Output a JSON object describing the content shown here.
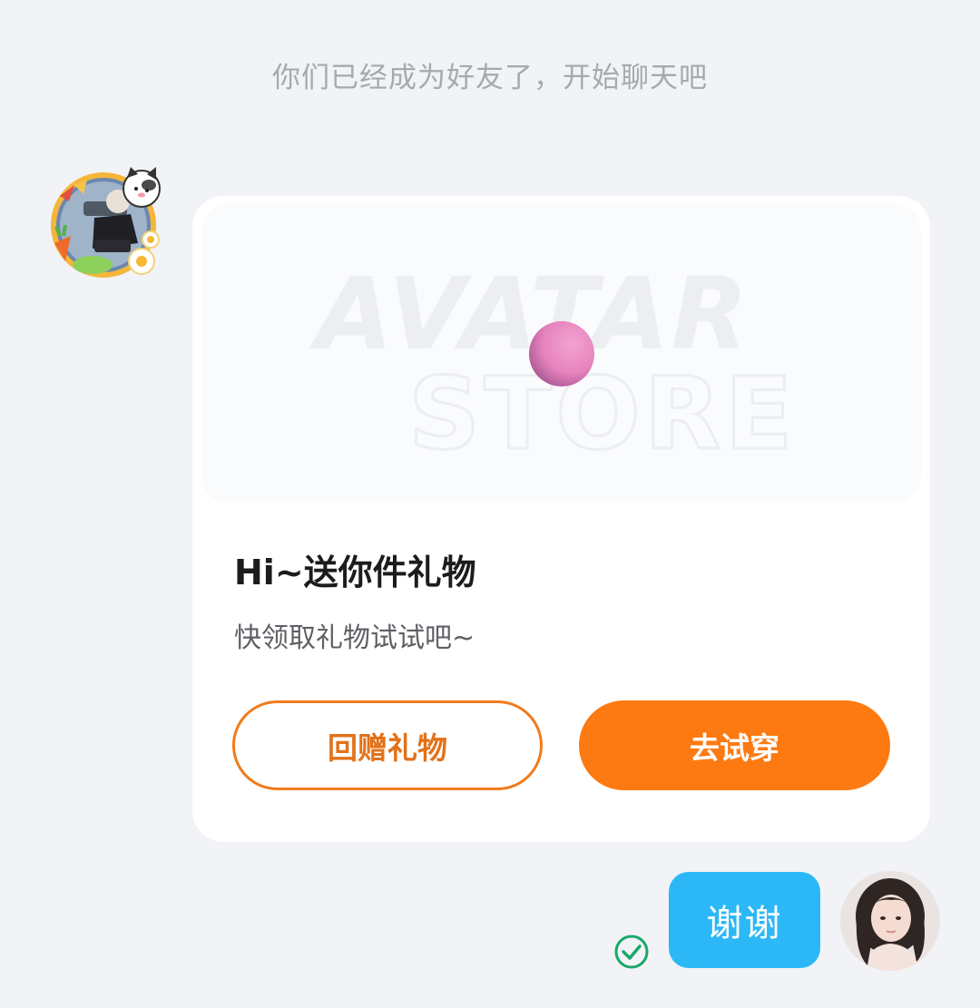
{
  "chat": {
    "system_message": "你们已经成为好友了，开始聊天吧"
  },
  "friend": {
    "avatar_icon": "friend-avatar-with-cat-frame"
  },
  "gift_card": {
    "preview_watermark_line1": "AVATAR",
    "preview_watermark_line2": "STORE",
    "title": "Hi~送你件礼物",
    "subtitle": "快领取礼物试试吧~",
    "return_gift_label": "回赠礼物",
    "try_on_label": "去试穿",
    "colors": {
      "accent": "#fd7a12",
      "outline": "#f07b1c"
    }
  },
  "my_message": {
    "text": "谢谢",
    "status_icon": "read-check-icon",
    "bubble_color": "#2cb8f6"
  }
}
